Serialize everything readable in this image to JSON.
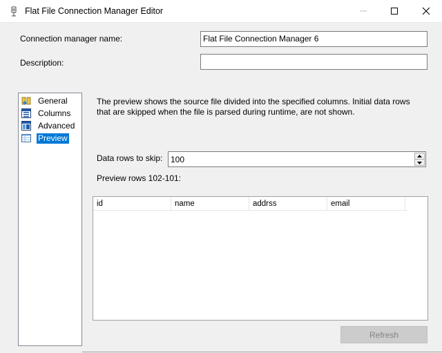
{
  "window": {
    "title": "Flat File Connection Manager Editor"
  },
  "form": {
    "name_label": "Connection manager name:",
    "name_value": "Flat File Connection Manager 6",
    "description_label": "Description:",
    "description_value": ""
  },
  "nav": {
    "items": [
      {
        "label": "General",
        "icon": "general-icon",
        "selected": false
      },
      {
        "label": "Columns",
        "icon": "columns-icon",
        "selected": false
      },
      {
        "label": "Advanced",
        "icon": "advanced-icon",
        "selected": false
      },
      {
        "label": "Preview",
        "icon": "preview-icon",
        "selected": true
      }
    ]
  },
  "preview": {
    "description": "The preview shows the source file divided into the specified columns. Initial data rows that are skipped when the file is parsed during runtime, are not shown.",
    "skip_label": "Data rows to skip:",
    "skip_value": "100",
    "rows_label": "Preview rows 102-101:",
    "columns": [
      "id",
      "name",
      "addrss",
      "email"
    ],
    "refresh_label": "Refresh"
  },
  "colors": {
    "selection": "#0078d7",
    "disabled_button_bg": "#cccccc",
    "disabled_button_text": "#838383"
  }
}
